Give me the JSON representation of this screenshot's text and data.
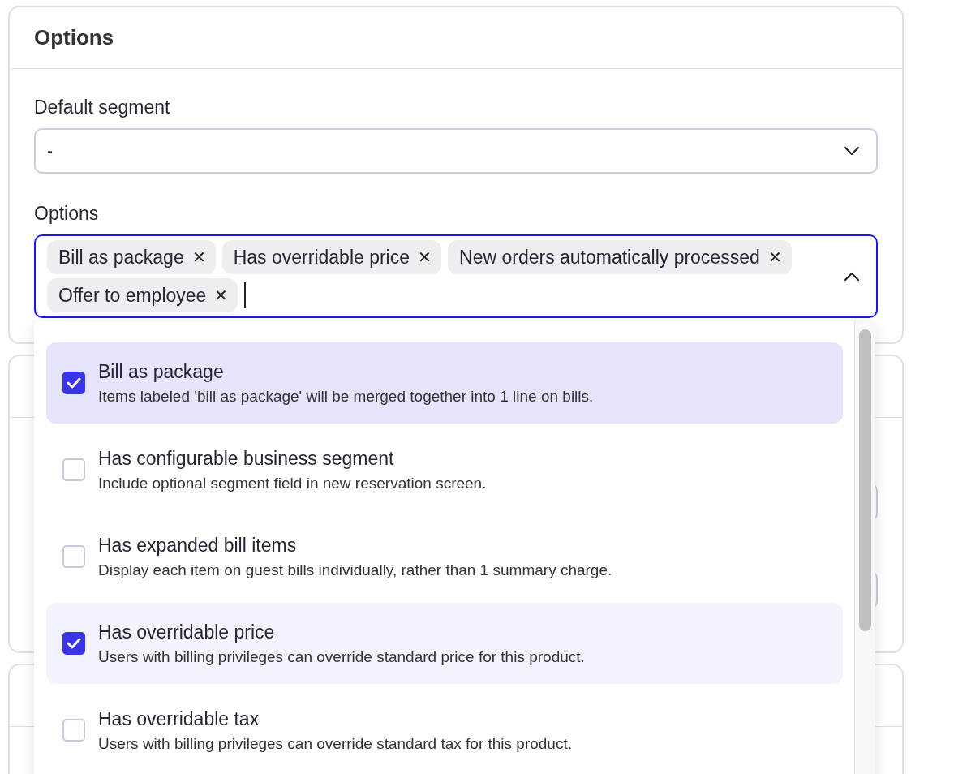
{
  "card": {
    "title": "Options"
  },
  "default_segment": {
    "label": "Default segment",
    "value": "-"
  },
  "options_field": {
    "label": "Options",
    "expanded": true,
    "chips": [
      {
        "label": "Bill as package",
        "remove": "✕"
      },
      {
        "label": "Has overridable price",
        "remove": "✕"
      },
      {
        "label": "New orders automatically processed",
        "remove": "✕"
      },
      {
        "label": "Offer to employee",
        "remove": "✕"
      }
    ]
  },
  "dropdown": {
    "items": [
      {
        "title": "Bill as package",
        "description": "Items labeled 'bill as package' will be merged together into 1 line on bills.",
        "checked": true,
        "active": true
      },
      {
        "title": "Has configurable business segment",
        "description": "Include optional segment field in new reservation screen.",
        "checked": false,
        "active": false
      },
      {
        "title": "Has expanded bill items",
        "description": "Display each item on guest bills individually, rather than 1 summary charge.",
        "checked": false,
        "active": false
      },
      {
        "title": "Has overridable price",
        "description": "Users with billing privileges can override standard price for this product.",
        "checked": true,
        "active": false
      },
      {
        "title": "Has overridable tax",
        "description": "Users with billing privileges can override standard tax for this product.",
        "checked": false,
        "active": false
      }
    ]
  }
}
